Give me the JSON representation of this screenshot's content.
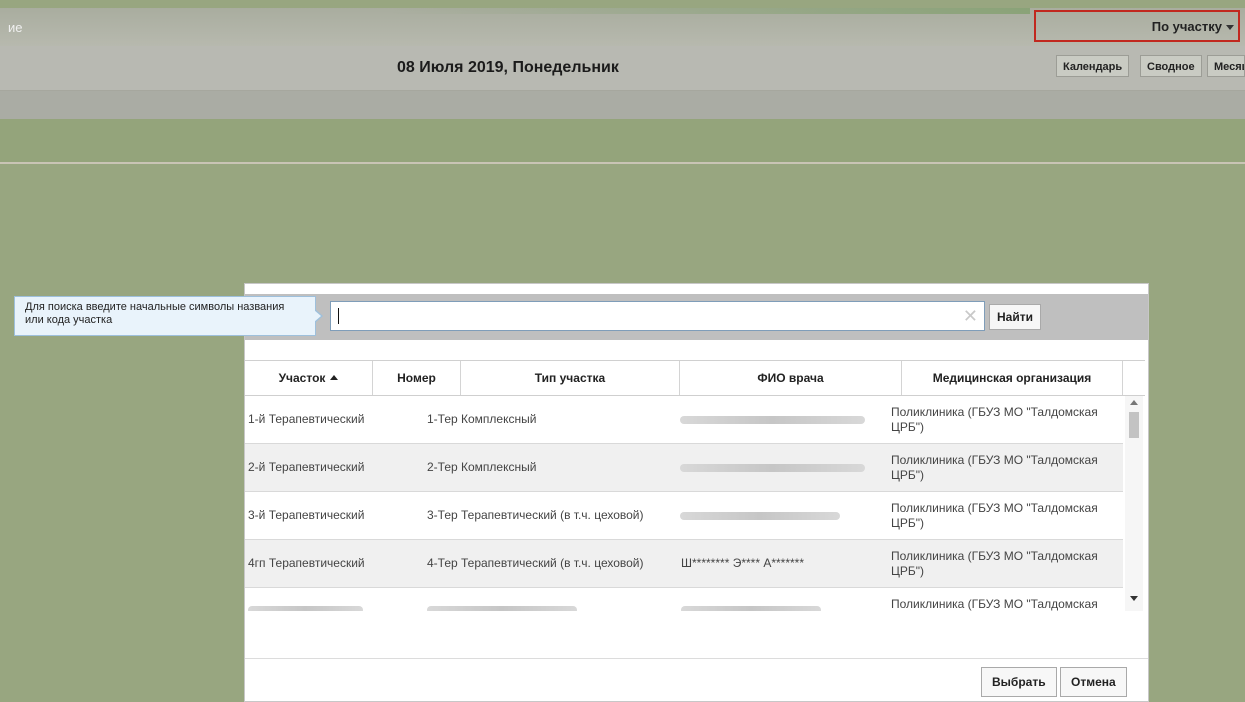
{
  "app": {
    "title_fragment": "ие",
    "view_selector": "По участку",
    "date": "08 Июля 2019, Понедельник",
    "view_buttons": [
      "Календарь",
      "Сводное",
      "Месяц"
    ]
  },
  "dialog": {
    "search": {
      "hint": "Для поиска введите начальные символы названия или кода участка",
      "value": "",
      "find_label": "Найти"
    },
    "table": {
      "columns": [
        "Участок",
        "Номер",
        "Тип участка",
        "ФИО врача",
        "Медицинская организация"
      ],
      "sorted_column": "Участок",
      "rows": [
        {
          "area": "1-й Терапевтический",
          "number": "1-Тер",
          "type": "Комплексный",
          "doctor": "",
          "org": "Поликлиника (ГБУЗ МО \"Талдомская ЦРБ\")"
        },
        {
          "area": "2-й Терапевтический",
          "number": "2-Тер",
          "type": "Комплексный",
          "doctor": "",
          "org": "Поликлиника (ГБУЗ МО \"Талдомская ЦРБ\")"
        },
        {
          "area": "3-й Терапевтический",
          "number": "3-Тер",
          "type": "Терапевтический (в т.ч. цеховой)",
          "doctor": "",
          "org": "Поликлиника (ГБУЗ МО \"Талдомская ЦРБ\")"
        },
        {
          "area": "4гп Терапевтический",
          "number": "4-Тер",
          "type": "Терапевтический (в т.ч. цеховой)",
          "doctor": "Ш******** Э**** А*******",
          "org": "Поликлиника (ГБУЗ МО \"Талдомская ЦРБ\")"
        },
        {
          "area": "",
          "number": "",
          "type": "",
          "doctor": "",
          "org": "Поликлиника (ГБУЗ МО \"Талдомская"
        }
      ]
    },
    "select_label": "Выбрать",
    "cancel_label": "Отмена"
  }
}
